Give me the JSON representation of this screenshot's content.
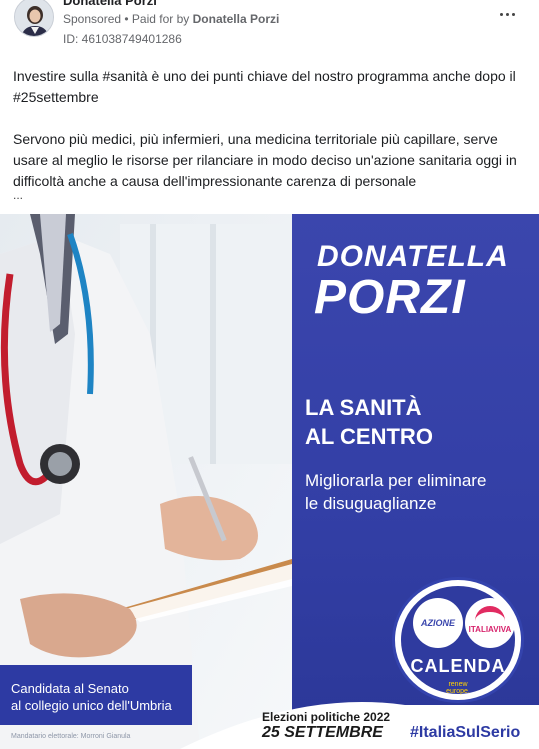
{
  "post": {
    "author": "Donatella Porzi",
    "sponsored_label": "Sponsored",
    "separator": " • ",
    "paid_for_label": "Paid for by",
    "payer": "Donatella Porzi",
    "ad_id": "ID: 461038749401286",
    "more_icon": "more-horizontal-icon",
    "paragraph_1": "Investire sulla #sanità è uno dei punti chiave del nostro programma anche dopo il #25settembre",
    "paragraph_2": "Servono più medici, più infermieri, una medicina territoriale più capillare, serve usare al meglio le risorse per rilanciare in modo deciso un'azione sanitaria oggi in difficoltà anche a causa dell'impressionante carenza di personale",
    "ellipsis": "..."
  },
  "creative": {
    "name_first": "DONATELLA",
    "name_last": "PORZI",
    "headline_1": "LA SANITÀ",
    "headline_2": "AL CENTRO",
    "subline_1": "Migliorarla per eliminare",
    "subline_2": "le disuguaglianze",
    "candidate_1": "Candidata al Senato",
    "candidate_2": "al collegio unico dell'Umbria",
    "mandate": "Mandatario elettorale: Morroni Gianula",
    "elections_label": "Elezioni politiche 2022",
    "date": "25 SETTEMBRE",
    "hashtag": "#ItaliaSulSerio",
    "logo": {
      "azione": "AZIONE",
      "italiaviva": "ITALIAVIVA",
      "calenda": "CALENDA",
      "renew_1": "renew",
      "renew_2": "europe."
    },
    "colors": {
      "brand_blue": "#3b46ad",
      "accent_pink": "#e12b61",
      "accent_yellow": "#ffd200"
    }
  }
}
